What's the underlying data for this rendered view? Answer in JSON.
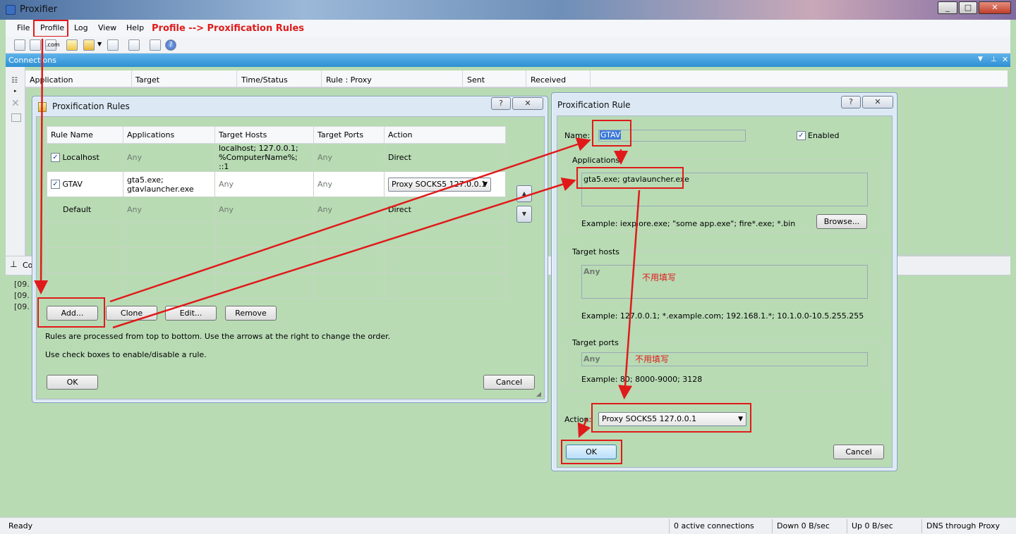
{
  "app": {
    "title": "Proxifier",
    "window_buttons": [
      "_",
      "□",
      "✕"
    ]
  },
  "menu": {
    "items": [
      "File",
      "Profile",
      "Log",
      "View",
      "Help"
    ]
  },
  "annotation": {
    "menu_path": "Profile --> Proxification Rules",
    "no_fill": "不用填写"
  },
  "toolbar": {
    "icons": [
      "connections-icon",
      "proxy-servers-icon",
      "dns-icon",
      "new-profile-icon",
      "open-profile-icon",
      "save-profile-icon",
      "import-icon",
      "print-icon",
      "help-icon"
    ]
  },
  "connections": {
    "title": "Connections",
    "columns": [
      "Application",
      "Target",
      "Time/Status",
      "Rule : Proxy",
      "Sent",
      "Received"
    ],
    "log_lines": [
      "[09.",
      "[09.",
      "[09."
    ]
  },
  "log_tab": {
    "label": "Co"
  },
  "status": {
    "ready": "Ready",
    "active": "0 active connections",
    "down": "Down 0 B/sec",
    "up": "Up 0 B/sec",
    "dns": "DNS through Proxy"
  },
  "rules_dialog": {
    "title": "Proxification Rules",
    "help": "?",
    "close": "✕",
    "columns": [
      "Rule Name",
      "Applications",
      "Target Hosts",
      "Target Ports",
      "Action"
    ],
    "rows": [
      {
        "checked": true,
        "name": "Localhost",
        "apps": "Any",
        "hosts_1": "localhost; 127.0.0.1;",
        "hosts_2": "%ComputerName%; ::1",
        "ports": "Any",
        "action": "Direct"
      },
      {
        "checked": true,
        "name": "GTAV",
        "apps_1": "gta5.exe;",
        "apps_2": "gtavlauncher.exe",
        "hosts": "Any",
        "ports": "Any",
        "action": "Proxy SOCKS5 127.0.0.1"
      },
      {
        "checked": false,
        "name": "Default",
        "apps": "Any",
        "hosts": "Any",
        "ports": "Any",
        "action": "Direct"
      }
    ],
    "buttons": {
      "add": "Add...",
      "clone": "Clone",
      "edit": "Edit...",
      "remove": "Remove",
      "ok": "OK",
      "cancel": "Cancel"
    },
    "hint_1": "Rules are processed from top to bottom. Use the arrows at the right to change the order.",
    "hint_2": "Use check boxes to enable/disable a rule."
  },
  "rule_dialog": {
    "title": "Proxification Rule",
    "help": "?",
    "close": "✕",
    "name_label": "Name:",
    "name_value": "GTAV",
    "enabled_label": "Enabled",
    "applications_label": "Applications",
    "applications_value": "gta5.exe; gtavlauncher.exe",
    "applications_example": "Example: iexplore.exe; \"some app.exe\"; fire*.exe; *.bin",
    "browse": "Browse...",
    "hosts_label": "Target hosts",
    "hosts_value": "Any",
    "hosts_example": "Example: 127.0.0.1; *.example.com; 192.168.1.*; 10.1.0.0-10.5.255.255",
    "ports_label": "Target ports",
    "ports_value": "Any",
    "ports_example": "Example: 80; 8000-9000; 3128",
    "action_label": "Action:",
    "action_value": "Proxy SOCKS5 127.0.0.1",
    "ok": "OK",
    "cancel": "Cancel"
  },
  "colors": {
    "grid_bg": "#b8dbb4",
    "accent_red": "#e01a1a",
    "title_blue": "#2e8fd3"
  }
}
